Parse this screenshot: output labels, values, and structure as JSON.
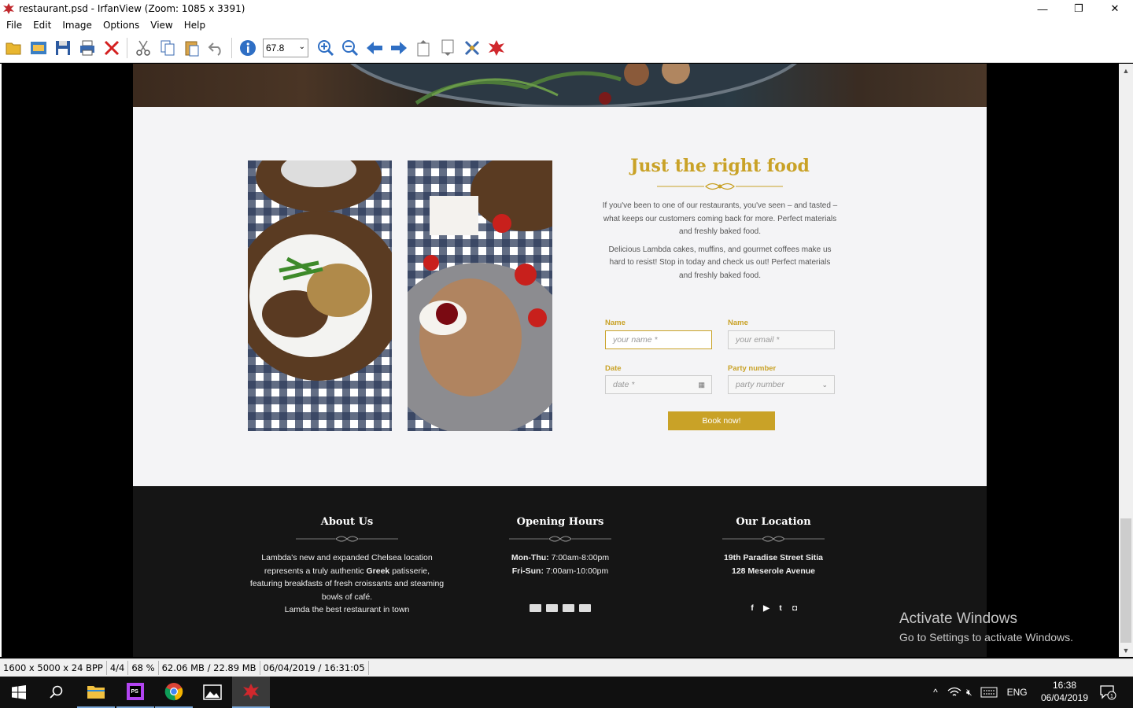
{
  "window": {
    "title": "restaurant.psd - IrfanView (Zoom: 1085 x 3391)",
    "controls": {
      "minimize": "—",
      "maximize": "❐",
      "close": "✕"
    }
  },
  "menu": [
    "File",
    "Edit",
    "Image",
    "Options",
    "View",
    "Help"
  ],
  "toolbar": {
    "zoom_value": "67.8"
  },
  "page": {
    "section_title": "Just the right food",
    "paragraph1": "If you've been to one of our restaurants, you've seen – and tasted – what keeps our customers coming back for more. Perfect materials and freshly baked food.",
    "paragraph2": "Delicious Lambda cakes,  muffins, and gourmet coffees make us hard to resist! Stop in today and check us out! Perfect materials and freshly baked food.",
    "form": {
      "name_label": "Name",
      "name_placeholder": "your name *",
      "email_label": "Name",
      "email_placeholder": "your email *",
      "date_label": "Date",
      "date_placeholder": "date *",
      "party_label": "Party number",
      "party_placeholder": "party number",
      "submit": "Book now!"
    },
    "footer": {
      "about_title": "About Us",
      "about_text_1": "Lambda's new and expanded Chelsea location represents a truly authentic ",
      "about_text_bold": "Greek",
      "about_text_2": " patisserie, featuring breakfasts of fresh croissants and steaming bowls of café.",
      "about_text_3": "Lamda the best restaurant in town",
      "hours_title": "Opening Hours",
      "hours_line1_label": "Mon-Thu:",
      "hours_line1_value": " 7:00am-8:00pm",
      "hours_line2_label": "Fri-Sun:",
      "hours_line2_value": " 7:00am-10:00pm",
      "location_title": "Our Location",
      "location_line1": "19th Paradise Street Sitia",
      "location_line2": "128 Meserole Avenue",
      "social": [
        "f",
        "▶",
        "t",
        "◘"
      ]
    },
    "accent_color": "#c9a227"
  },
  "watermark": {
    "line1": "Activate Windows",
    "line2": "Go to Settings to activate Windows."
  },
  "statusbar": [
    "1600 x 5000 x 24 BPP",
    "4/4",
    "68 %",
    "62.06 MB / 22.89 MB",
    "06/04/2019 / 16:31:05"
  ],
  "taskbar": {
    "language": "ENG",
    "time": "16:38",
    "date": "06/04/2019",
    "notifications": "1"
  }
}
